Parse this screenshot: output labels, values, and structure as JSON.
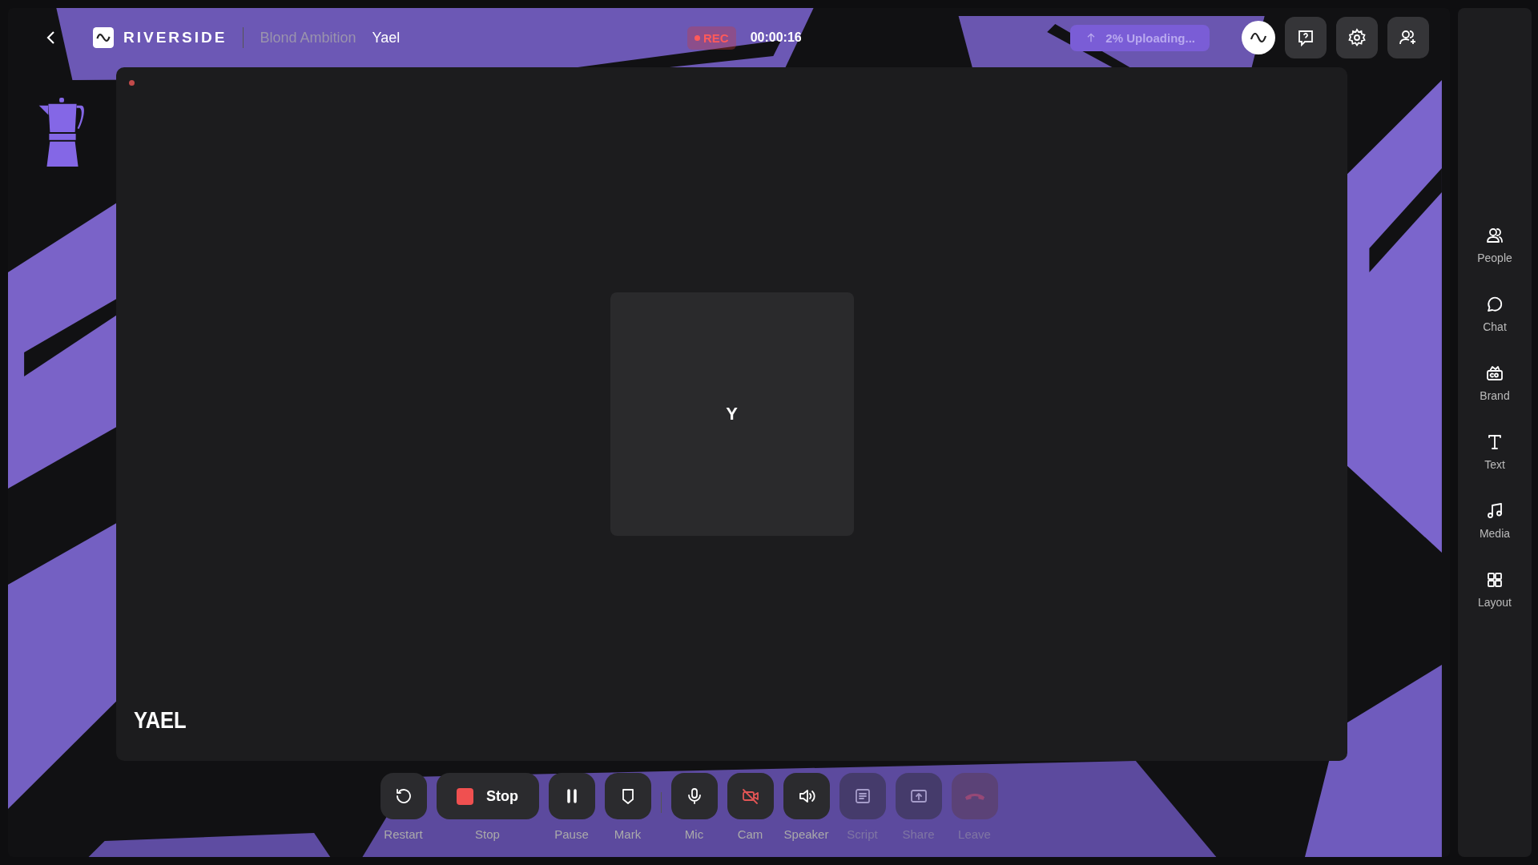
{
  "header": {
    "brand": "RIVERSIDE",
    "project": "Blond Ambition",
    "participant": "Yael",
    "recording": {
      "label": "REC",
      "on": true
    },
    "timer": "00:00:16",
    "upload": {
      "label": "2% Uploading..."
    }
  },
  "stage": {
    "speaker": {
      "initial": "Y",
      "name": "YAEL",
      "recording": true
    }
  },
  "toolbar": [
    {
      "kind": "restart",
      "label": "Restart",
      "off": false,
      "disabled": false
    },
    {
      "kind": "stop",
      "label": "Stop",
      "button_text": "Stop",
      "off": false,
      "disabled": false
    },
    {
      "kind": "pause",
      "label": "Pause",
      "off": false,
      "disabled": false
    },
    {
      "kind": "mark",
      "label": "Mark",
      "off": false,
      "disabled": false
    },
    {
      "kind": "mic",
      "label": "Mic",
      "off": false,
      "disabled": false
    },
    {
      "kind": "cam",
      "label": "Cam",
      "off": true,
      "disabled": false
    },
    {
      "kind": "speaker",
      "label": "Speaker",
      "off": false,
      "disabled": false
    },
    {
      "kind": "script",
      "label": "Script",
      "off": false,
      "disabled": true
    },
    {
      "kind": "share",
      "label": "Share",
      "off": false,
      "disabled": true
    },
    {
      "kind": "leave",
      "label": "Leave",
      "off": false,
      "disabled": true
    }
  ],
  "sidebar": {
    "items": [
      {
        "kind": "people",
        "label": "People"
      },
      {
        "kind": "chat",
        "label": "Chat"
      },
      {
        "kind": "brand",
        "label": "Brand"
      },
      {
        "kind": "text",
        "label": "Text"
      },
      {
        "kind": "media",
        "label": "Media"
      },
      {
        "kind": "layout",
        "label": "Layout"
      }
    ]
  }
}
